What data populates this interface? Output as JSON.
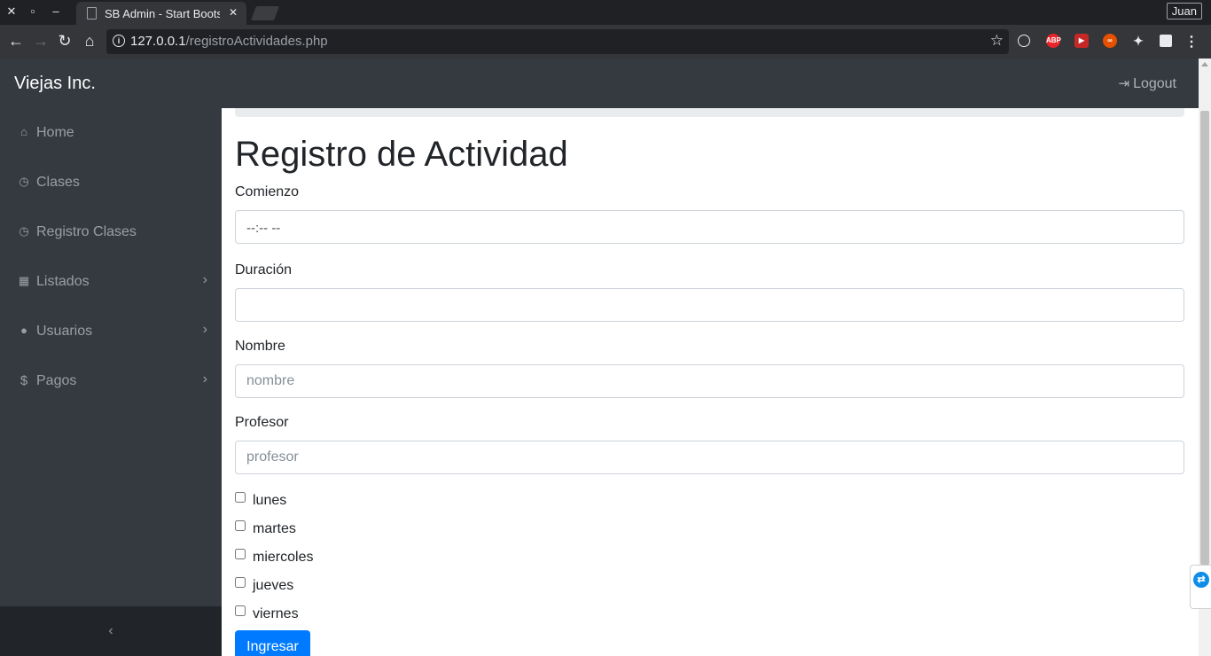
{
  "browser": {
    "tab_title": "SB Admin - Start Bootstrap Admin Template",
    "url_host": "127.0.0.1",
    "url_path": "/registroActividades.php",
    "profile_name": "Juan",
    "extensions": [
      "ABP"
    ]
  },
  "navbar": {
    "brand": "Viejas Inc.",
    "logout_label": "Logout"
  },
  "sidebar": {
    "items": [
      {
        "label": "Home",
        "icon": "home-icon",
        "has_submenu": false
      },
      {
        "label": "Clases",
        "icon": "clock-icon",
        "has_submenu": false
      },
      {
        "label": "Registro Clases",
        "icon": "clock-icon",
        "has_submenu": false
      },
      {
        "label": "Listados",
        "icon": "table-icon",
        "has_submenu": true
      },
      {
        "label": "Usuarios",
        "icon": "user-icon",
        "has_submenu": true
      },
      {
        "label": "Pagos",
        "icon": "dollar-icon",
        "has_submenu": true
      }
    ]
  },
  "form": {
    "title": "Registro de Actividad",
    "comienzo_label": "Comienzo",
    "comienzo_value": "--:-- --",
    "duracion_label": "Duración",
    "duracion_value": "",
    "nombre_label": "Nombre",
    "nombre_placeholder": "nombre",
    "profesor_label": "Profesor",
    "profesor_placeholder": "profesor",
    "days": [
      "lunes",
      "martes",
      "miercoles",
      "jueves",
      "viernes"
    ],
    "submit_label": "Ingresar"
  },
  "colors": {
    "sidebar_bg": "#343a40",
    "primary": "#007bff"
  }
}
